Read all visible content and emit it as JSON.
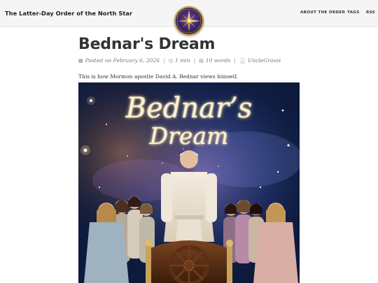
{
  "header": {
    "site_title": "The Latter-Day Order of the North Star",
    "nav": [
      "ABOUT THE ORDER",
      "TAGS",
      "RSS"
    ],
    "logo_icon": "compass-star-icon"
  },
  "post": {
    "title": "Bednar's Dream",
    "meta": {
      "posted": "Posted on February 6, 2026",
      "read_time": "1 min",
      "words": "10 words",
      "author": "UncleGravis"
    },
    "intro": "This is how Mormon apostle David A. Bednar views himself.",
    "image": {
      "title_line1": "Bednar’s",
      "title_line2": "Dream"
    }
  },
  "colors": {
    "topbar": "#f5f5f5",
    "title": "#333333",
    "meta": "#777777",
    "logo_ring": "#c9a24a"
  }
}
